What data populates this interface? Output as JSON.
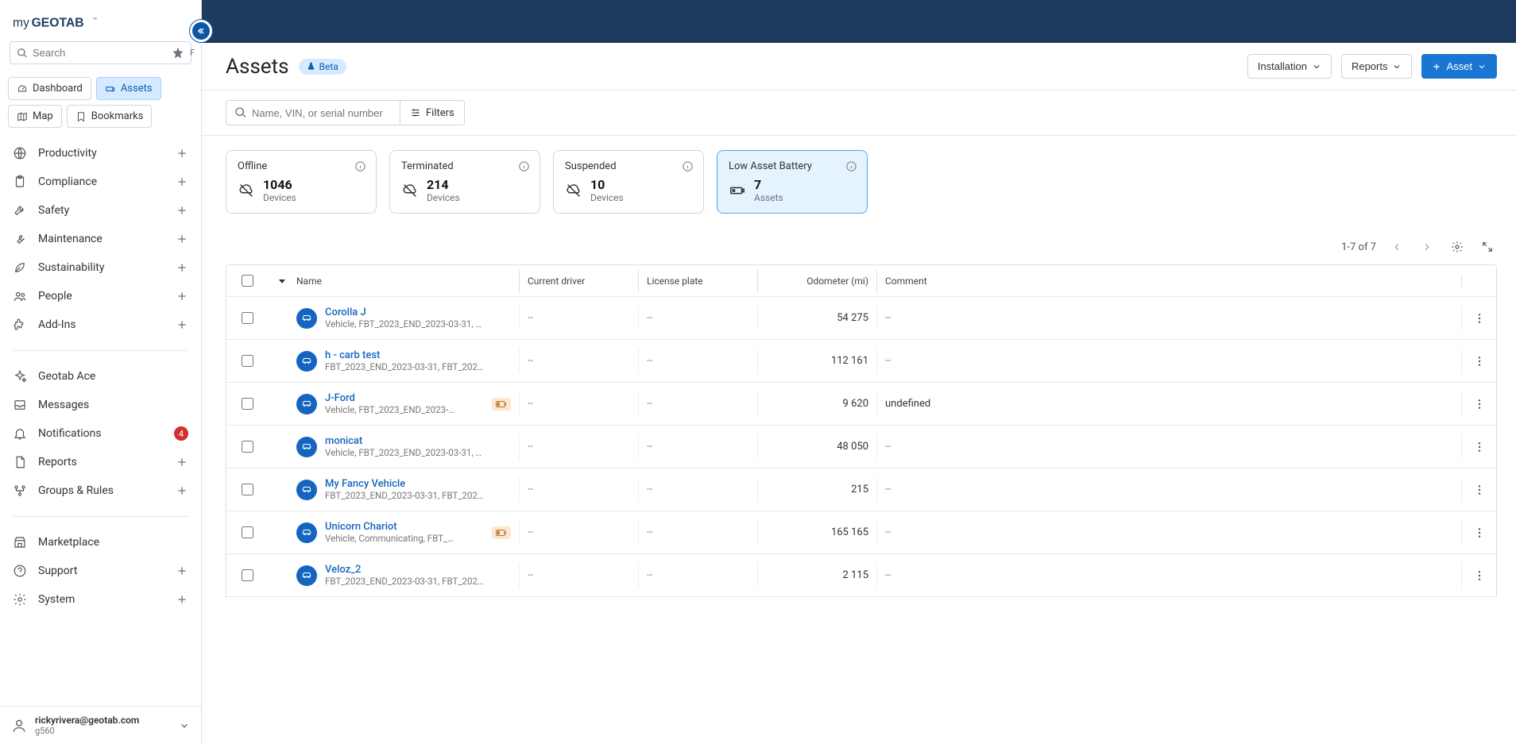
{
  "brand": {
    "name": "myGEOTAB"
  },
  "search": {
    "placeholder": "Search",
    "shortcut": "F"
  },
  "nav_tabs": {
    "dashboard": "Dashboard",
    "assets": "Assets",
    "map": "Map",
    "bookmarks": "Bookmarks"
  },
  "sidebar": {
    "items1": [
      {
        "label": "Productivity",
        "icon": "globe",
        "plus": true
      },
      {
        "label": "Compliance",
        "icon": "clipboard",
        "plus": true
      },
      {
        "label": "Safety",
        "icon": "wrench",
        "plus": true
      },
      {
        "label": "Maintenance",
        "icon": "tool",
        "plus": true
      },
      {
        "label": "Sustainability",
        "icon": "leaf",
        "plus": true
      },
      {
        "label": "People",
        "icon": "users",
        "plus": true
      },
      {
        "label": "Add-Ins",
        "icon": "puzzle",
        "plus": true
      }
    ],
    "items2": [
      {
        "label": "Geotab Ace",
        "icon": "sparkle"
      },
      {
        "label": "Messages",
        "icon": "inbox"
      },
      {
        "label": "Notifications",
        "icon": "bell",
        "badge": "4"
      },
      {
        "label": "Reports",
        "icon": "doc",
        "plus": true
      },
      {
        "label": "Groups & Rules",
        "icon": "hierarchy",
        "plus": true
      }
    ],
    "items3": [
      {
        "label": "Marketplace",
        "icon": "store"
      },
      {
        "label": "Support",
        "icon": "help",
        "plus": true
      },
      {
        "label": "System",
        "icon": "gear",
        "plus": true
      }
    ]
  },
  "user": {
    "email": "rickyrivera@geotab.com",
    "sub": "g560"
  },
  "header": {
    "title": "Assets",
    "beta": "Beta",
    "installation": "Installation",
    "reports": "Reports",
    "asset_btn": "Asset"
  },
  "filters": {
    "search_placeholder": "Name, VIN, or serial number",
    "filters_label": "Filters"
  },
  "stats": [
    {
      "label": "Offline",
      "value": "1046",
      "sub": "Devices",
      "icon": "cloud-off"
    },
    {
      "label": "Terminated",
      "value": "214",
      "sub": "Devices",
      "icon": "cloud-off"
    },
    {
      "label": "Suspended",
      "value": "10",
      "sub": "Devices",
      "icon": "cloud-off"
    },
    {
      "label": "Low Asset Battery",
      "value": "7",
      "sub": "Assets",
      "icon": "battery",
      "active": true
    }
  ],
  "table": {
    "pagination": "1-7 of 7",
    "columns": {
      "name": "Name",
      "driver": "Current driver",
      "plate": "License plate",
      "odo": "Odometer (mi)",
      "comment": "Comment"
    },
    "rows": [
      {
        "name": "Corolla J",
        "sub": "Vehicle, FBT_2023_END_2023-03-31, …",
        "driver": "--",
        "plate": "--",
        "odo": "54 275",
        "comment": "--",
        "low_batt": false
      },
      {
        "name": "h - carb test",
        "sub": "FBT_2023_END_2023-03-31, FBT_202…",
        "driver": "--",
        "plate": "--",
        "odo": "112 161",
        "comment": "--",
        "low_batt": false
      },
      {
        "name": "J-Ford",
        "sub": "Vehicle, FBT_2023_END_2023-…",
        "driver": "--",
        "plate": "--",
        "odo": "9 620",
        "comment": "undefined",
        "low_batt": true
      },
      {
        "name": "monicat",
        "sub": "Vehicle, FBT_2023_END_2023-03-31, …",
        "driver": "--",
        "plate": "--",
        "odo": "48 050",
        "comment": "--",
        "low_batt": false
      },
      {
        "name": "My Fancy Vehicle",
        "sub": "FBT_2023_END_2023-03-31, FBT_202…",
        "driver": "--",
        "plate": "--",
        "odo": "215",
        "comment": "--",
        "low_batt": false
      },
      {
        "name": "Unicorn Chariot",
        "sub": "Vehicle, Communicating, FBT_…",
        "driver": "--",
        "plate": "--",
        "odo": "165 165",
        "comment": "--",
        "low_batt": true
      },
      {
        "name": "Veloz_2",
        "sub": "FBT_2023_END_2023-03-31, FBT_202…",
        "driver": "--",
        "plate": "--",
        "odo": "2 115",
        "comment": "--",
        "low_batt": false
      }
    ]
  }
}
